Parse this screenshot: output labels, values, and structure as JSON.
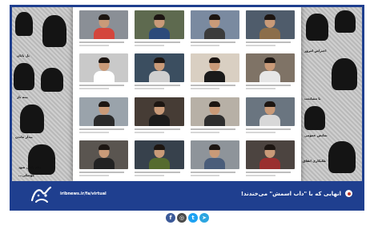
{
  "footer": {
    "caption": "انهایی که با \"داب اسمش\" می‌خندند!",
    "site_url": "iribnews.ir/fa/virtual"
  },
  "colors": {
    "brand_blue": "#1f3f8f",
    "facebook": "#3b5998",
    "instagram": "#4a4a4a",
    "twitter": "#1da1f2",
    "telegram": "#2ca5e0"
  },
  "side_captions": {
    "left": [
      "پل پایان",
      "پینه باز",
      "بیدار ماندن",
      "پیام پایان شود",
      "موشکی..."
    ],
    "right": [
      "اعتراض امروز",
      "با مشایعت",
      "نمایش عمومی",
      "طلبکاری اتفاق"
    ]
  },
  "feed": {
    "tiles": [
      {
        "icon": "person-thumb-icon"
      },
      {
        "icon": "person-thumb-icon"
      },
      {
        "icon": "person-thumb-icon"
      },
      {
        "icon": "person-thumb-icon"
      },
      {
        "icon": "person-thumb-icon"
      },
      {
        "icon": "person-thumb-icon"
      },
      {
        "icon": "person-thumb-icon"
      },
      {
        "icon": "person-thumb-icon"
      },
      {
        "icon": "person-thumb-icon"
      },
      {
        "icon": "person-thumb-icon"
      },
      {
        "icon": "person-thumb-icon"
      },
      {
        "icon": "person-thumb-icon"
      },
      {
        "icon": "person-thumb-icon"
      },
      {
        "icon": "person-thumb-icon"
      },
      {
        "icon": "person-thumb-icon"
      },
      {
        "icon": "person-thumb-icon"
      }
    ]
  },
  "social": {
    "icons": [
      "facebook-icon",
      "instagram-icon",
      "twitter-icon",
      "telegram-icon"
    ],
    "glyphs": [
      "f",
      "◎",
      "t",
      "➤"
    ]
  }
}
